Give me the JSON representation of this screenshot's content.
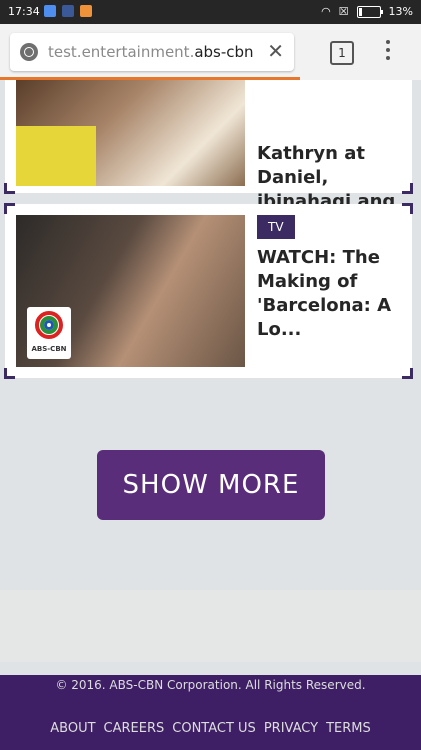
{
  "status_bar": {
    "time": "17:34",
    "battery": "13%"
  },
  "browser": {
    "url_prefix": "test.entertainment.",
    "url_domain": "abs-cbn",
    "tab_count": "1"
  },
  "articles": [
    {
      "title": "Kathryn at Daniel, ibinahagi ang kan...",
      "badge": ""
    },
    {
      "badge": "TV",
      "title": "WATCH: The Making of 'Barcelona: A Lo...",
      "logo_text": "ABS-CBN"
    }
  ],
  "show_more_label": "SHOW MORE",
  "footer": {
    "copyright": "© 2016. ABS-CBN Corporation. All Rights Reserved.",
    "links": [
      "ABOUT",
      "CAREERS",
      "CONTACT US",
      "PRIVACY",
      "TERMS"
    ]
  },
  "colors": {
    "brand_purple": "#3c2a63",
    "button_purple": "#5a2d7a",
    "loading_orange": "#e8772e"
  }
}
